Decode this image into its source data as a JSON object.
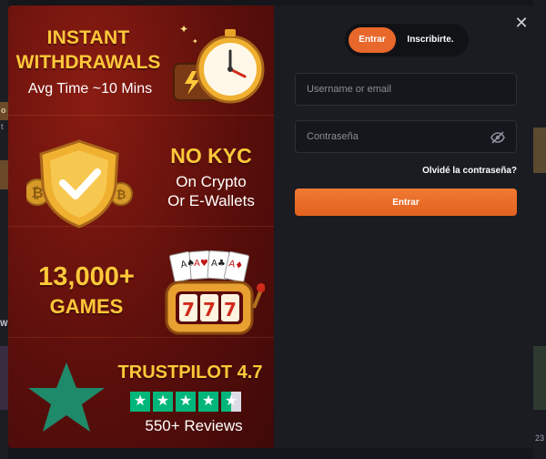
{
  "colors": {
    "accent": "#e8672a",
    "promo_gold": "#ffc83a",
    "promo_red": "#5c0f0b",
    "trustpilot_green": "#00b67a",
    "panel_bg": "#1a1c22"
  },
  "backdrop": {
    "left_fragments": [
      "o",
      "t",
      "W"
    ],
    "right_fragments": [
      "23"
    ]
  },
  "promo": {
    "withdrawals": {
      "title_line1": "INSTANT",
      "title_line2": "WITHDRAWALS",
      "subtitle": "Avg Time ~10 Mins",
      "icon": "stopwatch-wallet-icon"
    },
    "kyc": {
      "title": "NO KYC",
      "line1": "On Crypto",
      "line2": "Or E-Wallets",
      "icon": "shield-check-icon"
    },
    "games": {
      "count": "13,000+",
      "label": "GAMES",
      "icon": "slot-machine-icon"
    },
    "trustpilot": {
      "title": "TRUSTPILOT 4.7",
      "rating": 4.5,
      "max": 5,
      "reviews": "550+ Reviews",
      "icon": "trustpilot-star-icon"
    }
  },
  "login": {
    "close_icon": "close-icon",
    "tabs": [
      {
        "label": "Entrar",
        "active": true
      },
      {
        "label": "Inscribirte.",
        "active": false
      }
    ],
    "username_placeholder": "Username or email",
    "password_placeholder": "Contraseña",
    "password_icon": "eye-off-icon",
    "forgot_label": "Olvidé la contraseña?",
    "submit_label": "Entrar"
  }
}
